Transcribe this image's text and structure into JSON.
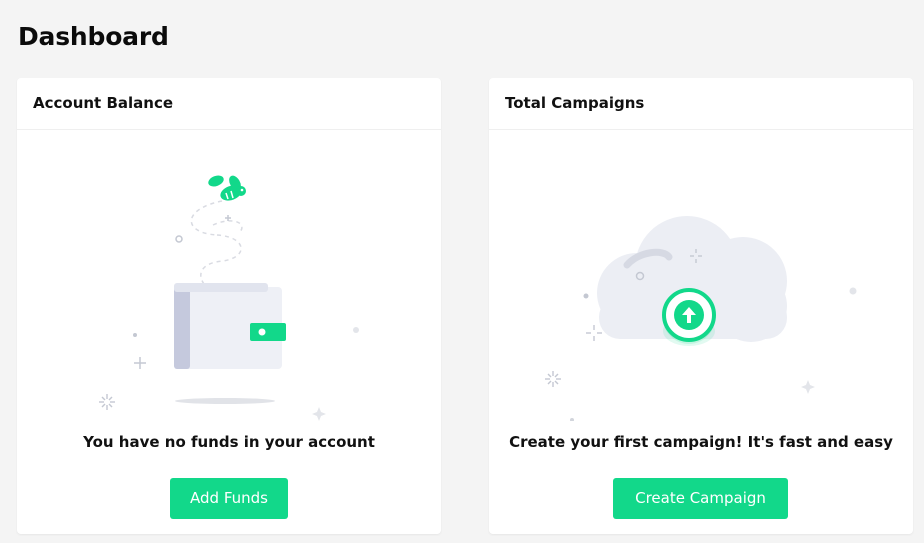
{
  "page": {
    "title": "Dashboard"
  },
  "cards": [
    {
      "title": "Account Balance",
      "message": "You have no funds in your account",
      "button_label": "Add Funds",
      "illustration": "wallet-with-bee"
    },
    {
      "title": "Total Campaigns",
      "message": "Create your first campaign! It's fast and easy",
      "button_label": "Create Campaign",
      "illustration": "cloud-upload"
    }
  ],
  "colors": {
    "accent": "#12d88a",
    "background": "#f4f4f4",
    "card": "#ffffff",
    "illustration_gray": "#eceef4"
  }
}
